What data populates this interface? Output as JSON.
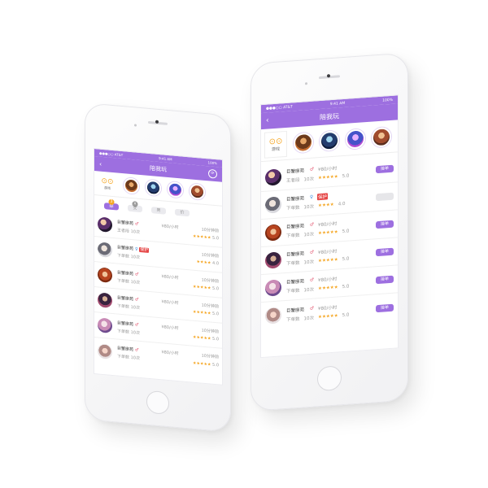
{
  "status": {
    "carrier": "●●●○○ AT&T",
    "time": "9:41 AM",
    "battery": "100%"
  },
  "nav": {
    "title": "陪我玩"
  },
  "strip": {
    "game_tab_label": "游戏"
  },
  "filters": {
    "left": [
      {
        "label": "综",
        "badge": "3",
        "badge_color": "#f5a623",
        "active": true
      },
      {
        "label": "女",
        "badge": "x",
        "badge_color": "#9a9a9a",
        "active": false
      },
      {
        "label": "男",
        "badge": "",
        "badge_color": "",
        "active": false
      },
      {
        "label": "价",
        "badge": "",
        "badge_color": "",
        "active": false
      }
    ]
  },
  "players": [
    {
      "name": "巨蟹座苑",
      "gender": "♂",
      "price": "¥80/小时",
      "distance": "10分钟前",
      "rank": "王者段",
      "count": "10次",
      "stars": "★★★★★",
      "score": "5.0",
      "tag": "",
      "subscribed": true
    },
    {
      "name": "巨蟹座苑",
      "gender": "♀",
      "price": "",
      "distance": "10分钟前",
      "rank": "下单数",
      "count": "10次",
      "stars": "★★★★",
      "score": "4.0",
      "tag": "保护",
      "subscribed": false
    },
    {
      "name": "巨蟹座苑",
      "gender": "♂",
      "price": "¥80/小时",
      "distance": "10分钟前",
      "rank": "下单数",
      "count": "10次",
      "stars": "★★★★★",
      "score": "5.0",
      "tag": "",
      "subscribed": true
    },
    {
      "name": "巨蟹座苑",
      "gender": "♂",
      "price": "¥80/小时",
      "distance": "10分钟前",
      "rank": "下单数",
      "count": "10次",
      "stars": "★★★★★",
      "score": "5.0",
      "tag": "",
      "subscribed": true
    },
    {
      "name": "巨蟹座苑",
      "gender": "♂",
      "price": "¥80/小时",
      "distance": "10分钟前",
      "rank": "下单数",
      "count": "10次",
      "stars": "★★★★★",
      "score": "5.0",
      "tag": "",
      "subscribed": true
    },
    {
      "name": "巨蟹座苑",
      "gender": "♂",
      "price": "¥80/小时",
      "distance": "10分钟前",
      "rank": "下单数",
      "count": "10次",
      "stars": "★★★★★",
      "score": "5.0",
      "tag": "",
      "subscribed": true
    }
  ],
  "buttons": {
    "subscribe_label": "接单"
  },
  "colors": {
    "accent": "#9d6fe0",
    "star": "#f5a623",
    "tag": "#e54646"
  }
}
